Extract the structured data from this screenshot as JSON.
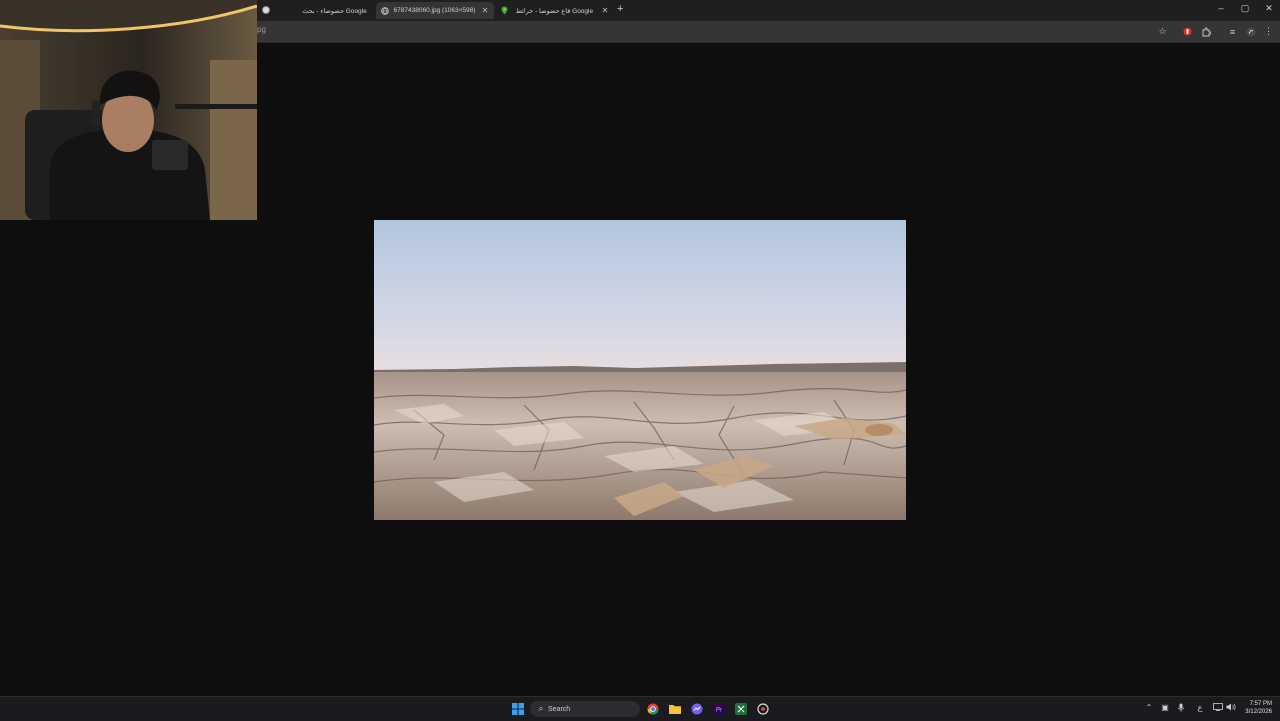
{
  "browser": {
    "tabs": [
      {
        "title": "حضوضاء - بحث Google",
        "active": false
      },
      {
        "title": "6787438060.jpg (1063×598)",
        "active": true
      },
      {
        "title": "قاع حضوضا - خرائط Google",
        "active": false
      }
    ],
    "address_text": "pg",
    "window_controls": {
      "minimize": "–",
      "restore": "▢",
      "close": "✕"
    },
    "colors": {
      "tab_bg": "#1f1f1f",
      "toolbar_bg": "#353535",
      "viewer_bg": "#0e0e0e"
    }
  },
  "viewer": {
    "image_name": "6787438060.jpg",
    "image_subject": "salt flat landscape at dusk"
  },
  "taskbar": {
    "search_label": "Search",
    "apps": [
      "start-icon",
      "chrome-icon",
      "file-explorer-icon",
      "messenger-icon",
      "premiere-icon",
      "excel-icon",
      "app-icon"
    ],
    "tray_lang": "ع",
    "clock_time": "7:57 PM",
    "clock_date": "3/12/2026",
    "colors": {
      "accent": "#0078d4",
      "taskbar_bg": "#1b1b1f"
    }
  }
}
